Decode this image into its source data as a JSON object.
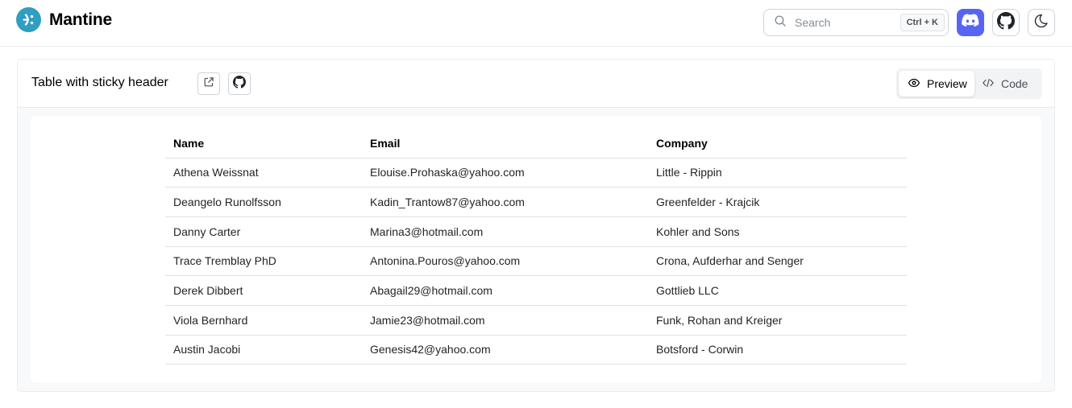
{
  "brand": {
    "name": "Mantine"
  },
  "header": {
    "search_placeholder": "Search",
    "search_shortcut": "Ctrl + K",
    "icons": [
      "search-icon",
      "discord-icon",
      "github-icon",
      "moon-icon"
    ],
    "discord_color": "#5865f2"
  },
  "demo": {
    "title": "Table with sticky header",
    "tabs": [
      {
        "label": "Preview",
        "icon": "eye-icon",
        "active": true
      },
      {
        "label": "Code",
        "icon": "code-icon",
        "active": false
      }
    ],
    "table": {
      "columns": [
        "Name",
        "Email",
        "Company"
      ],
      "rows": [
        [
          "Athena Weissnat",
          "Elouise.Prohaska@yahoo.com",
          "Little - Rippin"
        ],
        [
          "Deangelo Runolfsson",
          "Kadin_Trantow87@yahoo.com",
          "Greenfelder - Krajcik"
        ],
        [
          "Danny Carter",
          "Marina3@hotmail.com",
          "Kohler and Sons"
        ],
        [
          "Trace Tremblay PhD",
          "Antonina.Pouros@yahoo.com",
          "Crona, Aufderhar and Senger"
        ],
        [
          "Derek Dibbert",
          "Abagail29@hotmail.com",
          "Gottlieb LLC"
        ],
        [
          "Viola Bernhard",
          "Jamie23@hotmail.com",
          "Funk, Rohan and Kreiger"
        ],
        [
          "Austin Jacobi",
          "Genesis42@yahoo.com",
          "Botsford - Corwin"
        ]
      ]
    }
  }
}
